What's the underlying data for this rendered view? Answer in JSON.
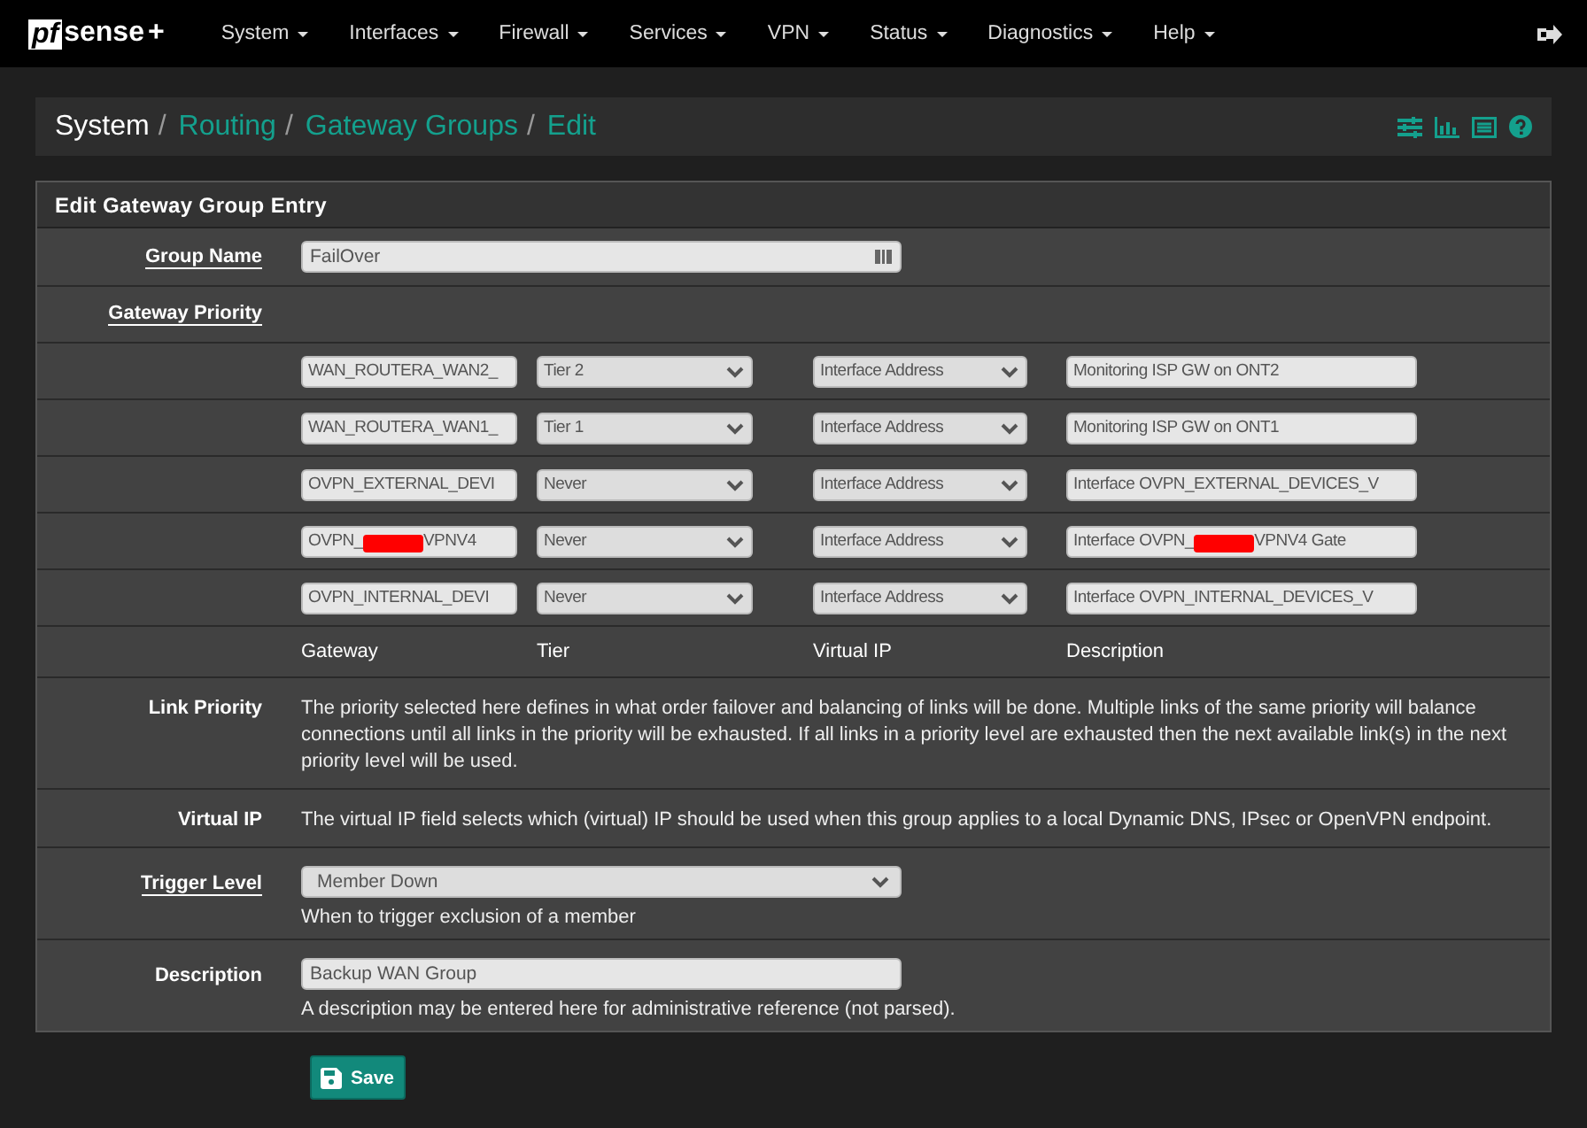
{
  "navbar": {
    "logo_left": "pf",
    "logo_right": "sense",
    "logo_plus": "+",
    "menus": [
      "System",
      "Interfaces",
      "Firewall",
      "Services",
      "VPN",
      "Status",
      "Diagnostics",
      "Help"
    ]
  },
  "breadcrumb": [
    {
      "label": "System",
      "link": false,
      "separator": "/"
    },
    {
      "label": "Routing",
      "link": true,
      "separator": "/"
    },
    {
      "label": "Gateway Groups",
      "link": true,
      "separator": "/"
    },
    {
      "label": "Edit",
      "link": true
    }
  ],
  "form": {
    "title": "Edit Gateway Group Entry",
    "group_name": {
      "label": "Group Name",
      "value": "FailOver"
    },
    "gateway_priority": {
      "label": "Gateway Priority",
      "rows": [
        {
          "gateway": [
            "WAN_ROUTERA_WAN2_"
          ],
          "tier": "Tier 2",
          "virtual_ip": "Interface Address",
          "description": [
            "Monitoring ISP GW on ONT2"
          ]
        },
        {
          "gateway": [
            "WAN_ROUTERA_WAN1_"
          ],
          "tier": "Tier 1",
          "virtual_ip": "Interface Address",
          "description": [
            "Monitoring ISP GW on  ONT1"
          ]
        },
        {
          "gateway": [
            "OVPN_EXTERNAL_DEVI"
          ],
          "tier": "Never",
          "virtual_ip": "Interface Address",
          "description": [
            "Interface OVPN_EXTERNAL_DEVICES_V"
          ]
        },
        {
          "gateway": [
            "OVPN_",
            "VPNV4"
          ],
          "tier": "Never",
          "virtual_ip": "Interface Address",
          "description": [
            "Interface OVPN_",
            "VPNV4 Gate"
          ]
        },
        {
          "gateway": [
            "OVPN_INTERNAL_DEVI"
          ],
          "tier": "Never",
          "virtual_ip": "Interface Address",
          "description": [
            "Interface OVPN_INTERNAL_DEVICES_V"
          ]
        }
      ],
      "columns": [
        "Gateway",
        "Tier",
        "Virtual IP",
        "Description"
      ]
    },
    "info": [
      {
        "label": "Link Priority",
        "text": "The priority selected here defines in what order failover and balancing of links will be done. Multiple links of the same priority will balance connections until all links in the priority will be exhausted. If all links in a priority level are exhausted then the next available link(s) in the next priority level will be used."
      },
      {
        "label": "Virtual IP",
        "text": "The virtual IP field selects which (virtual) IP should be used when this group applies to a local Dynamic DNS, IPsec or OpenVPN endpoint."
      }
    ],
    "trigger_level": {
      "label": "Trigger Level",
      "value": "Member Down",
      "help": "When to trigger exclusion of a member"
    },
    "description": {
      "label": "Description",
      "value": "Backup WAN Group",
      "help": "A description may be entered here for administrative reference (not parsed)."
    }
  },
  "save_button": "Save"
}
